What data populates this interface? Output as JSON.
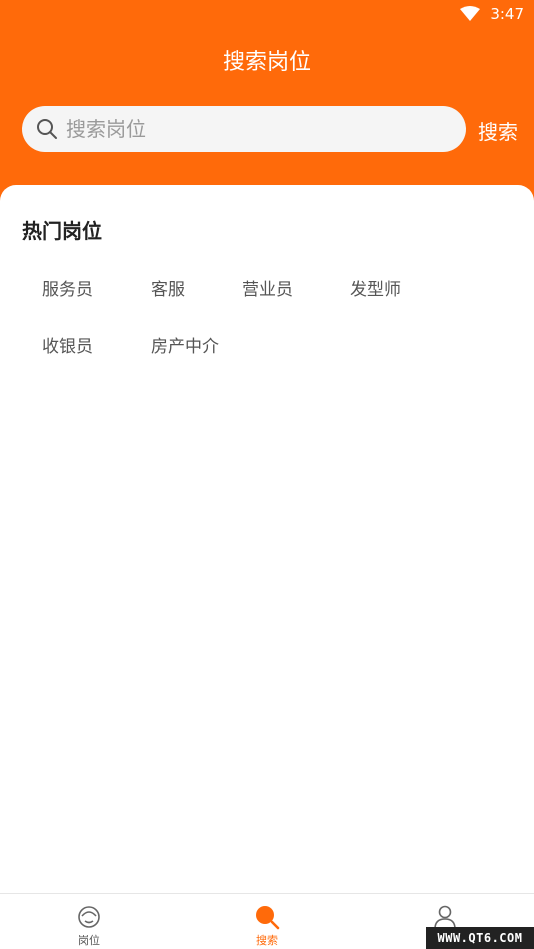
{
  "status_bar": {
    "time": "3:47",
    "wifi_icon": "wifi-icon"
  },
  "header": {
    "title": "搜索岗位",
    "search": {
      "placeholder": "搜索岗位",
      "value": "",
      "icon": "search-icon"
    },
    "search_button_label": "搜索"
  },
  "hot_jobs": {
    "title": "热门岗位",
    "tags": [
      "服务员",
      "客服",
      "营业员",
      "发型师",
      "收银员",
      "房产中介"
    ]
  },
  "tabbar": {
    "items": [
      {
        "label": "岗位",
        "icon": "job-icon",
        "active": false
      },
      {
        "label": "搜索",
        "icon": "search-icon",
        "active": true
      },
      {
        "label": "",
        "icon": "user-icon",
        "active": false
      }
    ]
  },
  "watermark": "WWW.QT6.COM",
  "colors": {
    "accent": "#ff6a0a",
    "background": "#ffffff",
    "search_box": "#f5f5f5"
  }
}
